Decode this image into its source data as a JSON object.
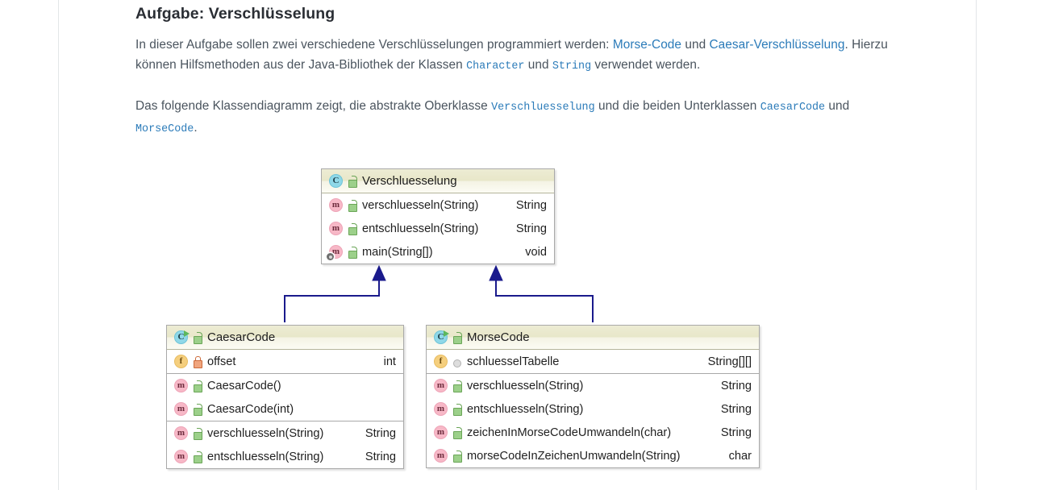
{
  "page": {
    "title": "Aufgabe: Verschlüsselung"
  },
  "paragraphs": {
    "p1": {
      "seg1": "In dieser Aufgabe sollen zwei verschiedene Verschlüsselungen programmiert werden: ",
      "link1": "Morse-Code",
      "seg2": " und ",
      "link2": "Caesar-Verschlüsselung",
      "seg3": ". Hierzu können Hilfsmethoden aus der Java-Bibliothek der Klassen ",
      "code1": "Character",
      "seg4": " und ",
      "code2": "String",
      "seg5": " verwendet werden."
    },
    "p2": {
      "seg1": "Das folgende Klassendiagramm zeigt, die abstrakte Oberklasse ",
      "code1": "Verschluesselung",
      "seg2": " und die beiden Unterklassen ",
      "code2": "CaesarCode",
      "seg3": " und ",
      "code3": "MorseCode",
      "seg4": "."
    }
  },
  "diagram": {
    "arrow_color": "#1a1a8c",
    "classes": {
      "superclass": {
        "name": "Verschluesselung",
        "icon": "class-icon",
        "visibility_icon": "public-lock-icon",
        "sections": [
          {
            "rows": [
              {
                "icon": "method-icon",
                "visibility_icon": "public-lock-icon",
                "static": false,
                "member": "verschluesseln(String)",
                "rettype": "String"
              },
              {
                "icon": "method-icon",
                "visibility_icon": "public-lock-icon",
                "static": false,
                "member": "entschluesseln(String)",
                "rettype": "String"
              },
              {
                "icon": "method-icon",
                "visibility_icon": "public-lock-icon",
                "static": true,
                "member": "main(String[])",
                "rettype": "void"
              }
            ]
          }
        ]
      },
      "caesar": {
        "name": "CaesarCode",
        "icon": "class-icon",
        "visibility_icon": "public-lock-icon",
        "sections": [
          {
            "rows": [
              {
                "icon": "field-icon",
                "visibility_icon": "private-lock-icon",
                "static": false,
                "member": "offset",
                "rettype": "int"
              }
            ]
          },
          {
            "rows": [
              {
                "icon": "method-icon",
                "visibility_icon": "public-lock-icon",
                "static": false,
                "member": "CaesarCode()",
                "rettype": ""
              },
              {
                "icon": "method-icon",
                "visibility_icon": "public-lock-icon",
                "static": false,
                "member": "CaesarCode(int)",
                "rettype": ""
              }
            ]
          },
          {
            "rows": [
              {
                "icon": "method-icon",
                "visibility_icon": "public-lock-icon",
                "static": false,
                "member": "verschluesseln(String)",
                "rettype": "String"
              },
              {
                "icon": "method-icon",
                "visibility_icon": "public-lock-icon",
                "static": false,
                "member": "entschluesseln(String)",
                "rettype": "String"
              }
            ]
          }
        ]
      },
      "morse": {
        "name": "MorseCode",
        "icon": "class-icon",
        "visibility_icon": "public-lock-icon",
        "sections": [
          {
            "rows": [
              {
                "icon": "field-icon",
                "visibility_icon": "package-dot-icon",
                "static": false,
                "member": "schluesselTabelle",
                "rettype": "String[][]"
              }
            ]
          },
          {
            "rows": [
              {
                "icon": "method-icon",
                "visibility_icon": "public-lock-icon",
                "static": false,
                "member": "verschluesseln(String)",
                "rettype": "String"
              },
              {
                "icon": "method-icon",
                "visibility_icon": "public-lock-icon",
                "static": false,
                "member": "entschluesseln(String)",
                "rettype": "String"
              },
              {
                "icon": "method-icon",
                "visibility_icon": "public-lock-icon",
                "static": false,
                "member": "zeichenInMorseCodeUmwandeln(char)",
                "rettype": "String"
              },
              {
                "icon": "method-icon",
                "visibility_icon": "public-lock-icon",
                "static": false,
                "member": "morseCodeInZeichenUmwandeln(String)",
                "rettype": "char"
              }
            ]
          }
        ]
      }
    }
  }
}
